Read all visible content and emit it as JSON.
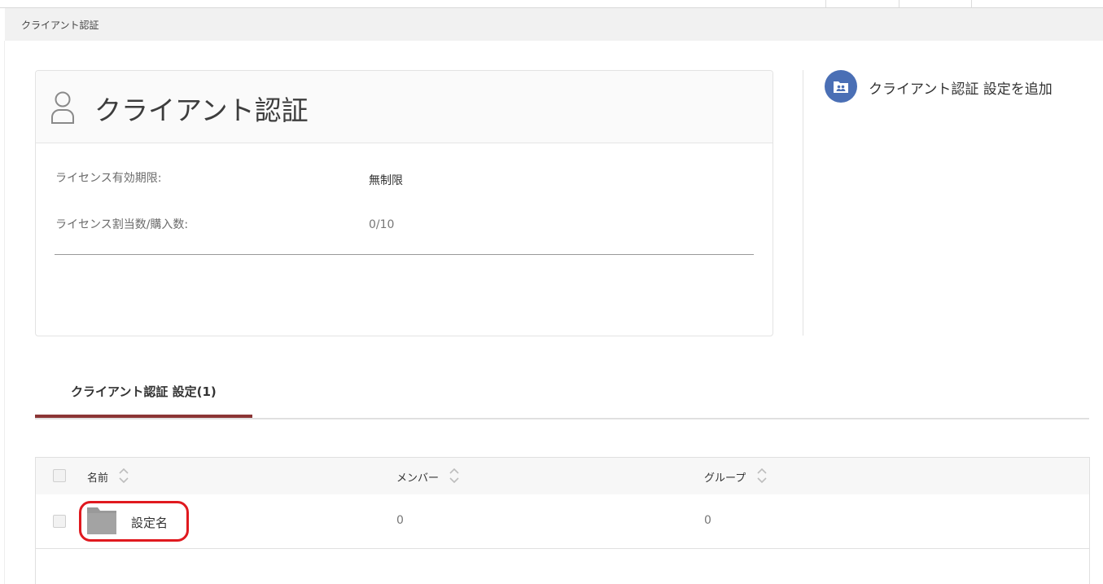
{
  "breadcrumb": "クライアント認証",
  "card": {
    "title": "クライアント認証",
    "rows": [
      {
        "label": "ライセンス有効期限:",
        "value": "無制限"
      },
      {
        "label": "ライセンス割当数/購入数:",
        "value": "0/10"
      }
    ]
  },
  "actions": {
    "add_label": "クライアント認証 設定を追加"
  },
  "tabs": [
    {
      "label": "クライアント認証 設定(1)",
      "active": true
    }
  ],
  "table": {
    "headers": {
      "name": "名前",
      "members": "メンバー",
      "groups": "グループ"
    },
    "rows": [
      {
        "name": "設定名",
        "members": "0",
        "groups": "0"
      }
    ]
  },
  "colors": {
    "accent": "#8b3535",
    "action_icon": "#4a6fb5",
    "highlight": "#e0191f"
  },
  "icons": [
    "user-icon",
    "add-group-folder-icon",
    "sort-icon",
    "folder-icon"
  ]
}
